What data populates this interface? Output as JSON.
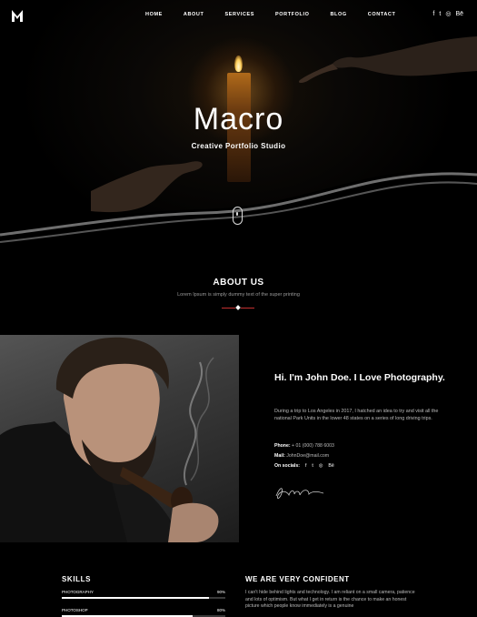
{
  "nav": {
    "logo_text": "M",
    "items": [
      "HOME",
      "ABOUT",
      "SERVICES",
      "PORTFOLIO",
      "BLOG",
      "CONTACT"
    ],
    "social_icons": [
      "facebook-icon",
      "twitter-icon",
      "instagram-icon",
      "behance-icon"
    ],
    "social_glyphs": [
      "f",
      "t",
      "◎",
      "Bē"
    ]
  },
  "hero": {
    "title": "Macro",
    "subtitle": "Creative Portfolio Studio"
  },
  "about": {
    "title": "ABOUT US",
    "subtitle": "Lorem Ipsum is simply dummy text of the super printing"
  },
  "bio": {
    "heading": "Hi. I'm John Doe. I Love Photography.",
    "text": "During a trip to Los Angeles in 2017, I hatched an idea to try and visit all the national Park Units in the lower 48 states on a series of long driving trips.",
    "phone_label": "Phone:",
    "phone": "+ 01 (000) 788 6003",
    "mail_label": "Mail:",
    "mail": "JohnDoe@mail.com",
    "social_label": "On socials:",
    "social_glyphs": [
      "f",
      "t",
      "◎",
      "Bē"
    ],
    "signature": "John Doe"
  },
  "skills": {
    "title": "SKILLS",
    "items": [
      {
        "label": "PHOTOGRAPHY",
        "value": "90%",
        "fraction": 0.9
      },
      {
        "label": "PHOTOSHOP",
        "value": "80%",
        "fraction": 0.8
      }
    ]
  },
  "confident": {
    "title": "WE ARE VERY CONFIDENT",
    "text": "I can't hide behind lights and technology. I am reliant on a small camera, patience and lots of optimism. But what I get in return is the chance to make an honest picture which people know immediately is a genuine"
  },
  "colors": {
    "accent": "#c43030",
    "background": "#000000"
  }
}
